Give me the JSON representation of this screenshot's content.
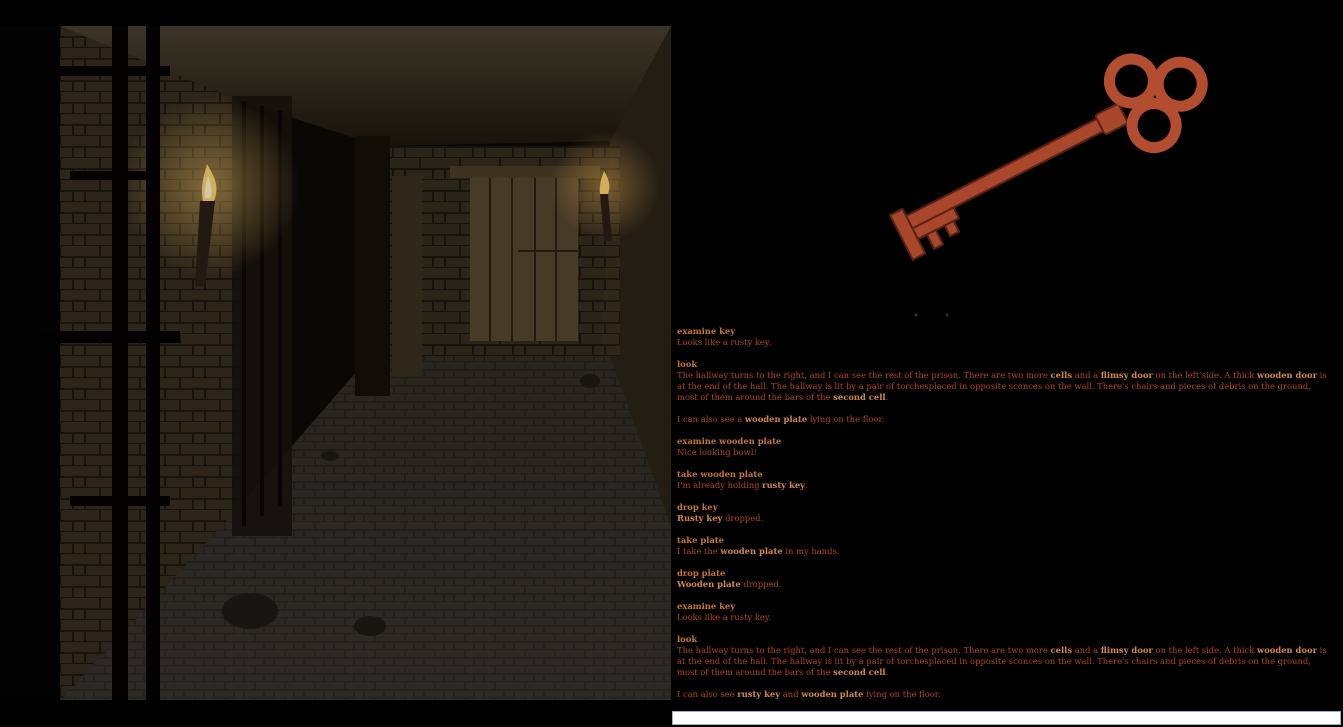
{
  "scene": {
    "description_icon": "dungeon-hallway-scene",
    "item_preview_icon": "rusty-key-icon"
  },
  "colors": {
    "log_text": "#b1461e",
    "command_text": "#c47834",
    "highlight_text": "#d3894b",
    "background": "#000000"
  },
  "log": [
    {
      "command": "examine key",
      "response": [
        [
          "t",
          "Looks like a rusty key."
        ]
      ]
    },
    {
      "command": "look",
      "response": [
        [
          "t",
          "The hallway turns to the right, and I can see the rest of the prison. There are two more "
        ],
        [
          "b",
          "cells"
        ],
        [
          "t",
          " and a "
        ],
        [
          "b",
          "flimsy door"
        ],
        [
          "t",
          " on the left side. A thick "
        ],
        [
          "b",
          "wooden door"
        ],
        [
          "t",
          " is at the end of the hall. The hallway is lit by a pair of torchesplaced in opposite sconces on the wall. There's chairs and pieces of debris on the ground, most of them around the bars of the "
        ],
        [
          "b",
          "second cell"
        ],
        [
          "t",
          "."
        ]
      ]
    },
    {
      "command": "",
      "response": [
        [
          "t",
          "I can also see a "
        ],
        [
          "b",
          "wooden plate"
        ],
        [
          "t",
          " lying on the floor."
        ]
      ]
    },
    {
      "command": "examine wooden plate",
      "response": [
        [
          "t",
          "Nice looking bowl!"
        ]
      ]
    },
    {
      "command": "take wooden plate",
      "response": [
        [
          "t",
          "I'm already holding "
        ],
        [
          "b",
          "rusty key"
        ],
        [
          "t",
          "."
        ]
      ]
    },
    {
      "command": "drop key",
      "response": [
        [
          "b",
          "Rusty key"
        ],
        [
          "t",
          " dropped."
        ]
      ]
    },
    {
      "command": "take plate",
      "response": [
        [
          "t",
          "I take the "
        ],
        [
          "b",
          "wooden plate"
        ],
        [
          "t",
          " in my hands."
        ]
      ]
    },
    {
      "command": "drop plate",
      "response": [
        [
          "b",
          "Wooden plate"
        ],
        [
          "t",
          " dropped."
        ]
      ]
    },
    {
      "command": "examine key",
      "response": [
        [
          "t",
          "Looks like a rusty key."
        ]
      ]
    },
    {
      "command": "look",
      "response": [
        [
          "t",
          "The hallway turns to the right, and I can see the rest of the prison. There are two more "
        ],
        [
          "b",
          "cells"
        ],
        [
          "t",
          " and a "
        ],
        [
          "b",
          "flimsy door"
        ],
        [
          "t",
          " on the left side. A thick "
        ],
        [
          "b",
          "wooden door"
        ],
        [
          "t",
          " is at the end of the hall. The hallway is lit by a pair of torchesplaced in opposite sconces on the wall. There's chairs and pieces of debris on the ground, most of them around the bars of the "
        ],
        [
          "b",
          "second cell"
        ],
        [
          "t",
          "."
        ]
      ]
    },
    {
      "command": "",
      "response": [
        [
          "t",
          "I can also see "
        ],
        [
          "b",
          "rusty key"
        ],
        [
          "t",
          " and "
        ],
        [
          "b",
          "wooden plate"
        ],
        [
          "t",
          " lying on the floor."
        ]
      ]
    }
  ],
  "input": {
    "value": "",
    "placeholder": ""
  }
}
